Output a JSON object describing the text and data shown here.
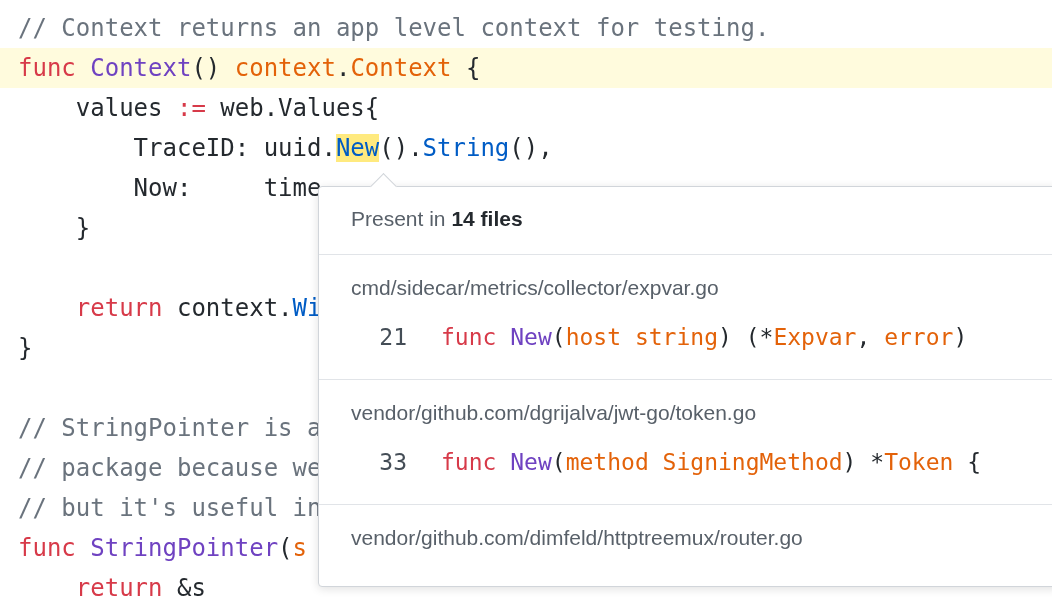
{
  "editor": {
    "lines": [
      {
        "highlighted": false,
        "tokens": [
          {
            "kind": "comment",
            "text": "// Context returns an app level context for testing."
          }
        ]
      },
      {
        "highlighted": true,
        "tokens": [
          {
            "kind": "keyword",
            "text": "func "
          },
          {
            "kind": "func",
            "text": "Context"
          },
          {
            "kind": "plain",
            "text": "() "
          },
          {
            "kind": "type",
            "text": "context"
          },
          {
            "kind": "plain",
            "text": "."
          },
          {
            "kind": "type",
            "text": "Context"
          },
          {
            "kind": "plain",
            "text": " {"
          }
        ]
      },
      {
        "highlighted": false,
        "tokens": [
          {
            "kind": "plain",
            "text": "    values "
          },
          {
            "kind": "keyword",
            "text": ":="
          },
          {
            "kind": "plain",
            "text": " web.Values{"
          }
        ]
      },
      {
        "highlighted": false,
        "tokens": [
          {
            "kind": "plain",
            "text": "        TraceID: uuid."
          },
          {
            "kind": "match",
            "text": "New"
          },
          {
            "kind": "plain",
            "text": "()."
          },
          {
            "kind": "method",
            "text": "String"
          },
          {
            "kind": "plain",
            "text": "(),"
          }
        ]
      },
      {
        "highlighted": false,
        "tokens": [
          {
            "kind": "plain",
            "text": "        Now:     time"
          }
        ]
      },
      {
        "highlighted": false,
        "tokens": [
          {
            "kind": "plain",
            "text": "    }"
          }
        ]
      },
      {
        "highlighted": false
      },
      {
        "highlighted": false,
        "tokens": [
          {
            "kind": "keyword",
            "text": "    return"
          },
          {
            "kind": "plain",
            "text": " context."
          },
          {
            "kind": "method",
            "text": "Wi"
          }
        ]
      },
      {
        "highlighted": false,
        "tokens": [
          {
            "kind": "plain",
            "text": "}"
          }
        ]
      },
      {
        "highlighted": false
      },
      {
        "highlighted": false,
        "tokens": [
          {
            "kind": "comment",
            "text": "// StringPointer is a"
          }
        ]
      },
      {
        "highlighted": false,
        "tokens": [
          {
            "kind": "comment",
            "text": "// package because we"
          }
        ]
      },
      {
        "highlighted": false,
        "tokens": [
          {
            "kind": "comment",
            "text": "// but it's useful in"
          }
        ]
      },
      {
        "highlighted": false,
        "tokens": [
          {
            "kind": "keyword",
            "text": "func "
          },
          {
            "kind": "func",
            "text": "StringPointer"
          },
          {
            "kind": "plain",
            "text": "("
          },
          {
            "kind": "type",
            "text": "s"
          }
        ]
      },
      {
        "highlighted": false,
        "tokens": [
          {
            "kind": "keyword",
            "text": "    return"
          },
          {
            "kind": "plain",
            "text": " &s"
          }
        ]
      }
    ]
  },
  "popup": {
    "summary": "Present in **14 files**",
    "results": [
      {
        "path": "cmd/sidecar/metrics/collector/expvar.go",
        "line_number": "21",
        "tokens": [
          {
            "kind": "keyword",
            "text": "func "
          },
          {
            "kind": "func",
            "text": "New"
          },
          {
            "kind": "plain",
            "text": "("
          },
          {
            "kind": "type",
            "text": "host string"
          },
          {
            "kind": "plain",
            "text": ") (*"
          },
          {
            "kind": "type",
            "text": "Expvar"
          },
          {
            "kind": "plain",
            "text": ", "
          },
          {
            "kind": "type",
            "text": "error"
          },
          {
            "kind": "plain",
            "text": ")"
          }
        ]
      },
      {
        "path": "vendor/github.com/dgrijalva/jwt-go/token.go",
        "line_number": "33",
        "tokens": [
          {
            "kind": "keyword",
            "text": "func "
          },
          {
            "kind": "func",
            "text": "New"
          },
          {
            "kind": "plain",
            "text": "("
          },
          {
            "kind": "type",
            "text": "method SigningMethod"
          },
          {
            "kind": "plain",
            "text": ") *"
          },
          {
            "kind": "type",
            "text": "Token"
          },
          {
            "kind": "plain",
            "text": " {"
          }
        ]
      },
      {
        "path": "vendor/github.com/dimfeld/httptreemux/router.go"
      }
    ]
  }
}
